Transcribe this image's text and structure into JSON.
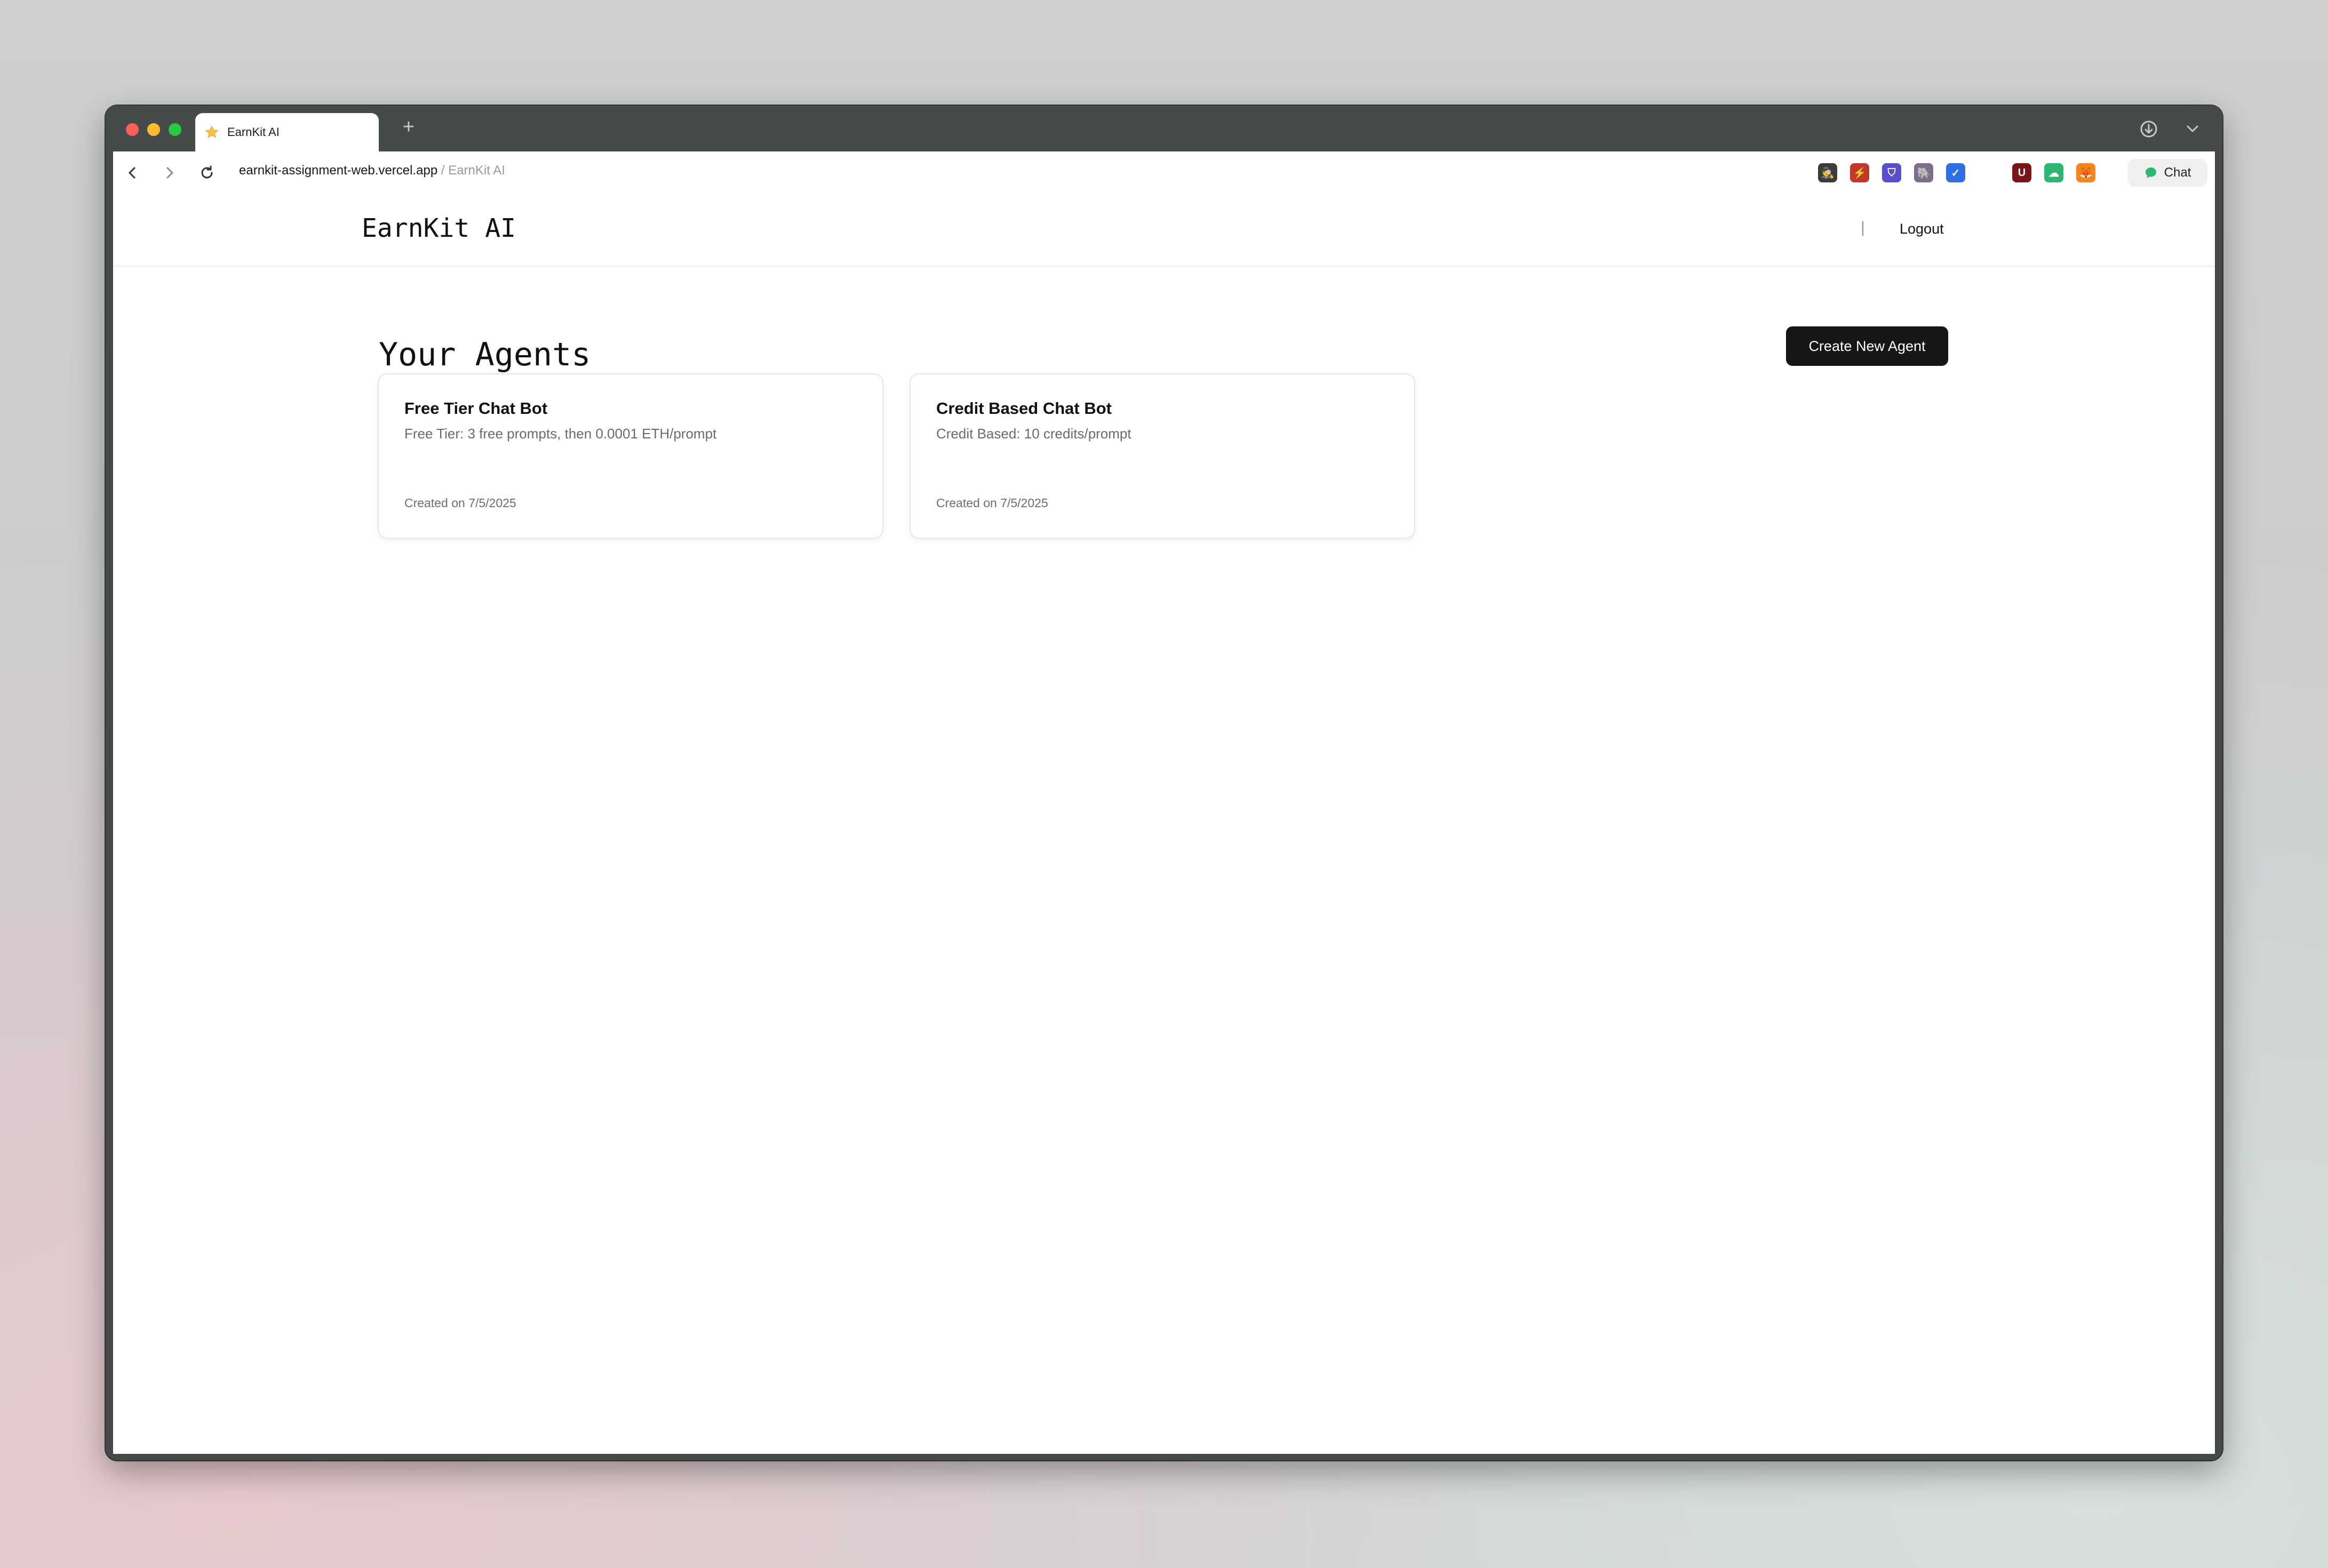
{
  "browser": {
    "tab_title": "EarnKit AI",
    "url_domain": "earnkit-assignment-web.vercel.app",
    "url_separator": "/",
    "url_page_title": "EarnKit AI",
    "chat_label": "Chat",
    "extensions": [
      {
        "name": "spy-extension-icon",
        "glyph": "🕵",
        "color": "#3c3c3c"
      },
      {
        "name": "red-extension-icon",
        "glyph": "⚡",
        "color": "#c0392b"
      },
      {
        "name": "shield-extension-icon",
        "glyph": "⛉",
        "color": "#5b4fc9"
      },
      {
        "name": "elephant-extension-icon",
        "glyph": "🐘",
        "color": "#7d6f8c"
      },
      {
        "name": "blue-check-extension-icon",
        "glyph": "✓",
        "color": "#2f6fe4"
      },
      {
        "name": "ublock-extension-icon",
        "glyph": "U",
        "color": "#7b1418"
      },
      {
        "name": "cloud-extension-icon",
        "glyph": "☁",
        "color": "#2bb673"
      },
      {
        "name": "metamask-extension-icon",
        "glyph": "🦊",
        "color": "#f6851b"
      }
    ]
  },
  "header": {
    "brand": "EarnKit AI",
    "divider": "|",
    "logout_label": "Logout"
  },
  "main": {
    "title": "Your Agents",
    "create_button_label": "Create New Agent",
    "agents": [
      {
        "name": "Free Tier Chat Bot",
        "description": "Free Tier: 3 free prompts, then 0.0001 ETH/prompt",
        "created": "Created on 7/5/2025"
      },
      {
        "name": "Credit Based Chat Bot",
        "description": "Credit Based: 10 credits/prompt",
        "created": "Created on 7/5/2025"
      }
    ]
  },
  "colors": {
    "primary_button": "#161616",
    "window_chrome": "#464a4a",
    "chat_icon": "#2bb673"
  }
}
